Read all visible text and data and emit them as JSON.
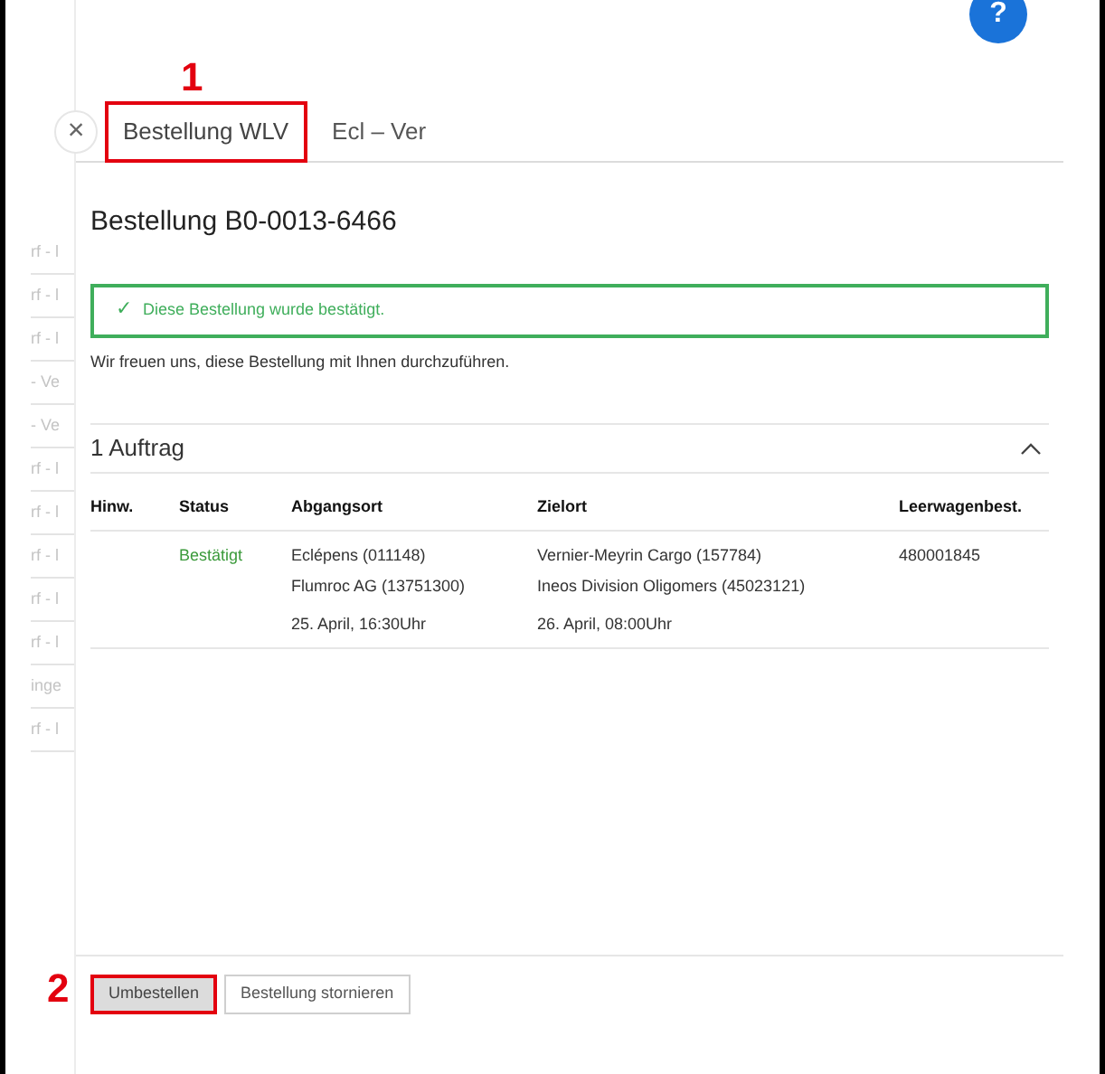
{
  "background_list": [
    "rf - l",
    "rf - l",
    "rf - l",
    "- Ve",
    "- Ve",
    "rf - l",
    "rf - l",
    "rf - l",
    "rf - l",
    "rf - l",
    "inge",
    "rf - l"
  ],
  "help_button": {
    "label": "?"
  },
  "tabs": [
    {
      "label": "Bestellung WLV",
      "selected": true,
      "marker": "1"
    },
    {
      "label": "Ecl – Ver",
      "selected": false
    }
  ],
  "close_label": "×",
  "title": "Bestellung B0-0013-6466",
  "alert": {
    "icon": "✓",
    "text": "Diese Bestellung wurde bestätigt."
  },
  "message": "Wir freuen uns, diese Bestellung mit Ihnen durchzuführen.",
  "section": {
    "title": "1 Auftrag",
    "expanded": true
  },
  "table": {
    "columns": [
      "Hinw.",
      "Status",
      "Abgangsort",
      "Zielort",
      "Leerwagenbest."
    ],
    "rows": [
      {
        "status": "Bestätigt",
        "origin": [
          "Eclépens (011148)",
          "Flumroc AG (13751300)"
        ],
        "origin_time": "25. April, 16:30Uhr",
        "destination": [
          "Vernier-Meyrin Cargo (157784)",
          "Ineos Division Oligomers (45023121)"
        ],
        "destination_time": "26. April, 08:00Uhr",
        "wagon_order": "480001845"
      }
    ]
  },
  "buttons": [
    {
      "label": "Umbestellen",
      "kind": "primary",
      "marker": "2"
    },
    {
      "label": "Bestellung stornieren",
      "kind": "secondary"
    }
  ]
}
